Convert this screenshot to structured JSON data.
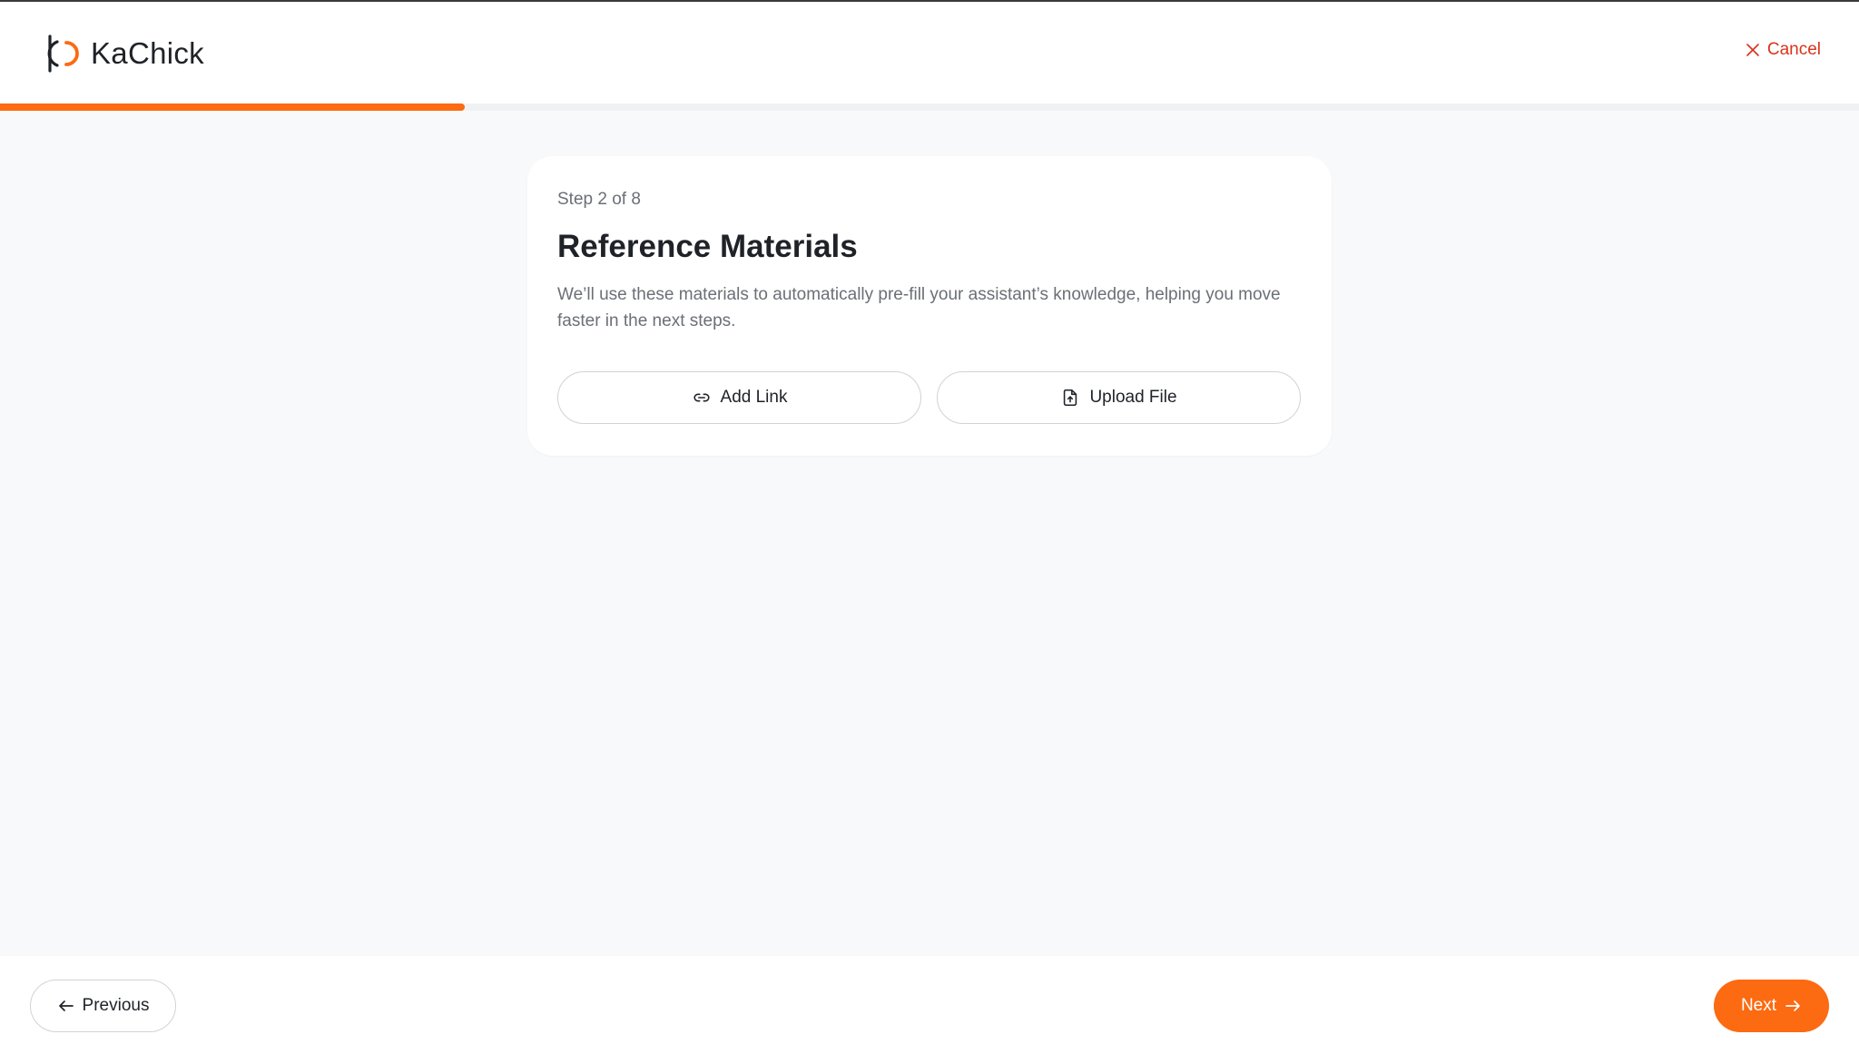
{
  "brand": {
    "name": "KaChick",
    "accent_color": "#fc6a12",
    "dark_color": "#1f2328"
  },
  "header": {
    "cancel_label": "Cancel",
    "cancel_icon": "close-icon",
    "cancel_color": "#d9331c"
  },
  "progress": {
    "current_step": 2,
    "total_steps": 8,
    "fraction": 0.25
  },
  "card": {
    "step_label": "Step 2 of 8",
    "title": "Reference Materials",
    "description": "We’ll use these materials to automatically pre-fill your assistant’s knowledge, helping you move faster in the next steps.",
    "actions": [
      {
        "label": "Add Link",
        "icon": "link-icon"
      },
      {
        "label": "Upload File",
        "icon": "file-upload-icon"
      }
    ]
  },
  "footer": {
    "previous_label": "Previous",
    "previous_icon": "arrow-left-icon",
    "next_label": "Next",
    "next_icon": "arrow-right-icon"
  }
}
